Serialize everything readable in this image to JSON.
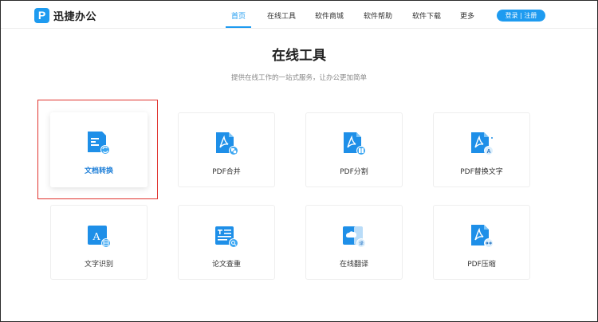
{
  "header": {
    "logo_letter": "P",
    "logo_text": "迅捷办公",
    "nav": [
      "首页",
      "在线工具",
      "软件商城",
      "软件帮助",
      "软件下载",
      "更多"
    ],
    "active_index": 0,
    "login_label": "登录 | 注册"
  },
  "main": {
    "title": "在线工具",
    "subtitle": "提供在线工作的一站式服务，让办公更加简单",
    "tools": [
      {
        "label": "文档转换",
        "icon": "document-convert-icon"
      },
      {
        "label": "PDF合并",
        "icon": "pdf-merge-icon"
      },
      {
        "label": "PDF分割",
        "icon": "pdf-split-icon"
      },
      {
        "label": "PDF替换文字",
        "icon": "pdf-replace-text-icon"
      },
      {
        "label": "文字识别",
        "icon": "text-recognition-icon"
      },
      {
        "label": "论文查重",
        "icon": "paper-check-icon"
      },
      {
        "label": "在线翻译",
        "icon": "online-translate-icon"
      },
      {
        "label": "PDF压缩",
        "icon": "pdf-compress-icon"
      }
    ],
    "badge_text": {
      "translate": "译",
      "recognition": "A"
    }
  },
  "colors": {
    "accent": "#1e9bf0",
    "highlight_box": "#e0332e"
  }
}
